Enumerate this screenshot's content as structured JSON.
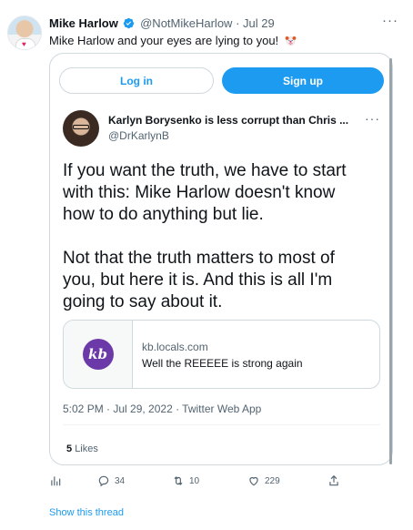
{
  "tweet": {
    "author_name": "Mike Harlow",
    "handle": "@NotMikeHarlow",
    "separator": "·",
    "date": "Jul 29",
    "text": "Mike Harlow and your eyes are lying to you!",
    "more_label": "···",
    "avatar_icon": "profile-avatar",
    "verified_icon": "verified-badge-icon",
    "emoji_icon": "clown-face-emoji"
  },
  "embed": {
    "login_label": "Log in",
    "signup_label": "Sign up",
    "quoted": {
      "author_name": "Karlyn Borysenko is less corrupt than Chris ...",
      "handle": "@DrKarlynB",
      "more_label": "···",
      "paragraphs": [
        "If you want the truth, we have to start",
        "with this: Mike Harlow doesn't know",
        "how to do anything but lie.",
        "Not that the truth matters to most of",
        "you, but here it is. And this is all I'm",
        "going to say about it."
      ],
      "link_card": {
        "logo_text": "kb",
        "domain": "kb.locals.com",
        "title": "Well the REEEEE is strong again"
      },
      "timestamp": "5:02 PM · Jul 29, 2022 · Twitter Web App",
      "likes_count": "5",
      "likes_label": "Likes"
    }
  },
  "actions": {
    "analytics_icon": "analytics-icon",
    "reply_count": "34",
    "retweet_count": "10",
    "like_count": "229",
    "share_icon": "share-icon"
  },
  "show_thread_label": "Show this thread",
  "colors": {
    "accent": "#1d9bf0",
    "text_primary": "#0f1419",
    "text_secondary": "#536471",
    "border": "#cfd9de",
    "locals_logo": "#6b3aa8"
  }
}
